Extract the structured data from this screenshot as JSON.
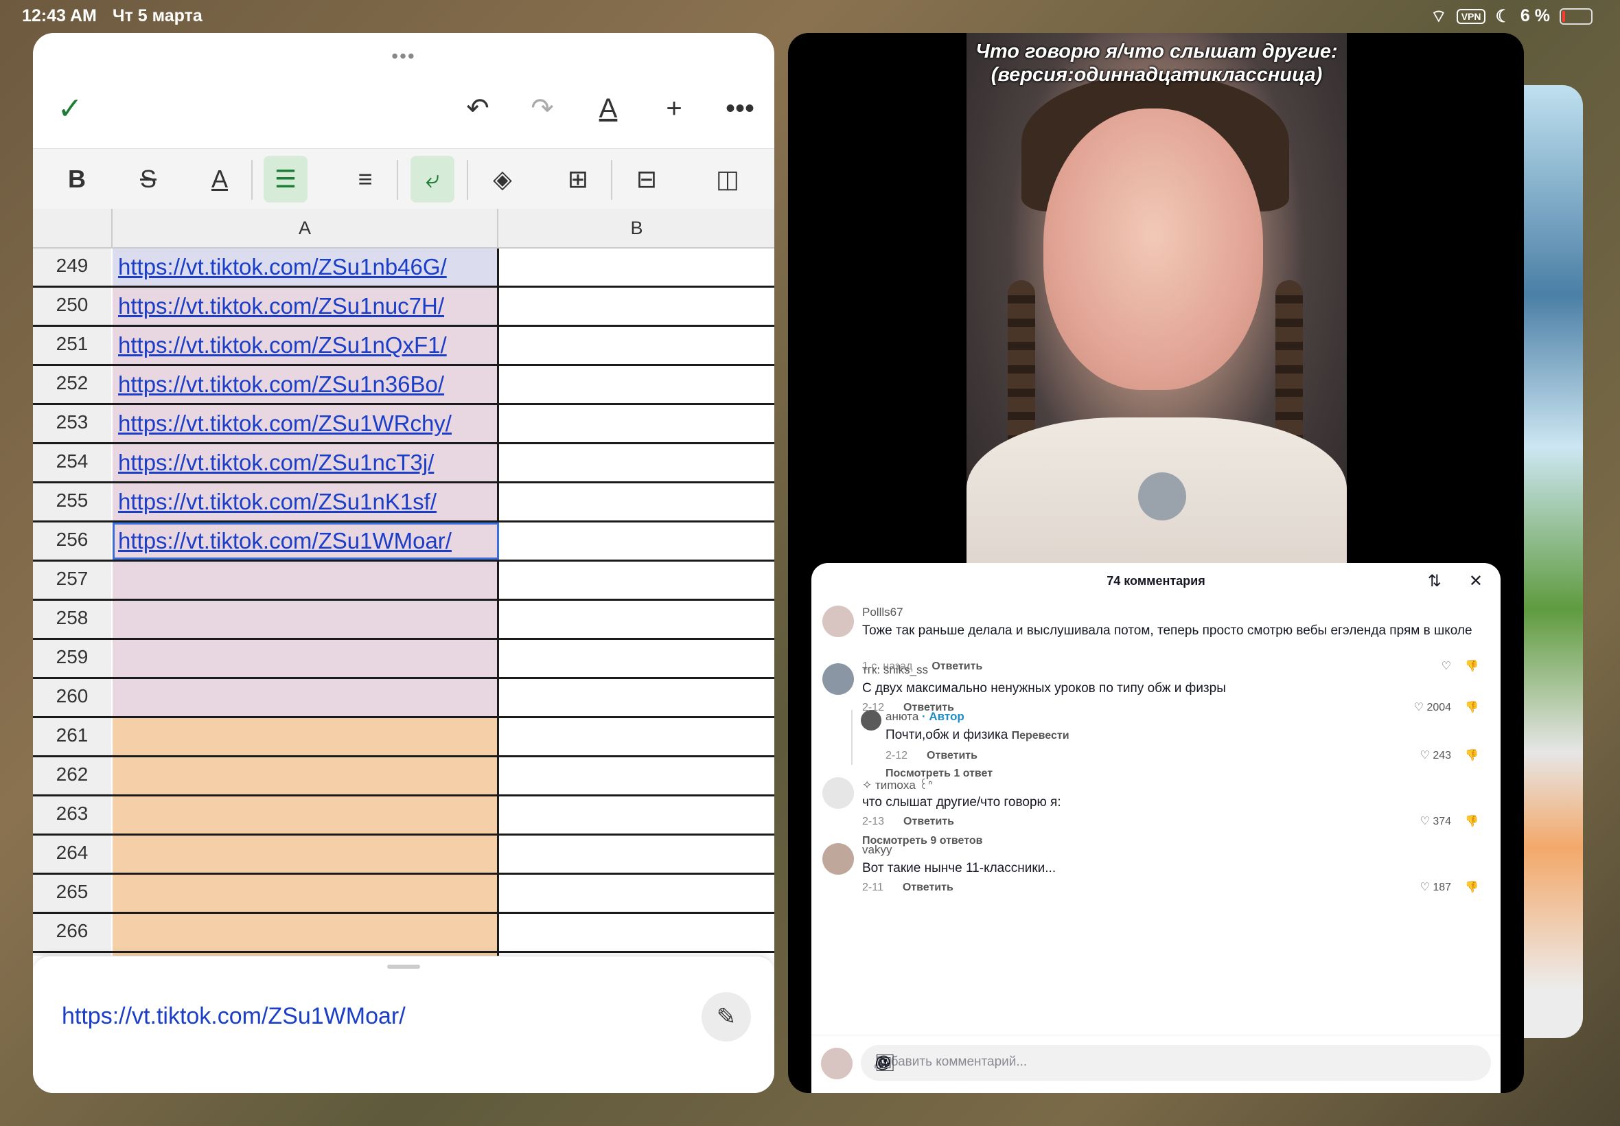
{
  "status": {
    "time": "12:43 AM",
    "date": "Чт 5 марта",
    "vpn": "VPN",
    "battery": "6 %"
  },
  "sheet": {
    "col_a": "A",
    "col_b": "B",
    "rows": [
      {
        "num": "249",
        "link": "https://vt.tiktok.com/ZSu1nb46G/",
        "color": "#dcdcef"
      },
      {
        "num": "250",
        "link": "https://vt.tiktok.com/ZSu1nuc7H/",
        "color": "#e8d6e0"
      },
      {
        "num": "251",
        "link": "https://vt.tiktok.com/ZSu1nQxF1/",
        "color": "#e8d6e0"
      },
      {
        "num": "252",
        "link": "https://vt.tiktok.com/ZSu1n36Bo/",
        "color": "#e8d6e0"
      },
      {
        "num": "253",
        "link": "https://vt.tiktok.com/ZSu1WRchy/",
        "color": "#e8d6e0"
      },
      {
        "num": "254",
        "link": "https://vt.tiktok.com/ZSu1ncT3j/",
        "color": "#e8d6e0"
      },
      {
        "num": "255",
        "link": "https://vt.tiktok.com/ZSu1nK1sf/",
        "color": "#e8d6e0"
      },
      {
        "num": "256",
        "link": "https://vt.tiktok.com/ZSu1WMoar/",
        "color": "#e8d6e0"
      },
      {
        "num": "257",
        "link": "",
        "color": "#e8d6e0"
      },
      {
        "num": "258",
        "link": "",
        "color": "#e8d6e0"
      },
      {
        "num": "259",
        "link": "",
        "color": "#e8d6e0"
      },
      {
        "num": "260",
        "link": "",
        "color": "#e8d6e0"
      },
      {
        "num": "261",
        "link": "",
        "color": "#f4cfa8"
      },
      {
        "num": "262",
        "link": "",
        "color": "#f4cfa8"
      },
      {
        "num": "263",
        "link": "",
        "color": "#f4cfa8"
      },
      {
        "num": "264",
        "link": "",
        "color": "#f4cfa8"
      },
      {
        "num": "265",
        "link": "",
        "color": "#f4cfa8"
      },
      {
        "num": "266",
        "link": "",
        "color": "#f4cfa8"
      },
      {
        "num": "267",
        "link": "",
        "color": "#f4cfa8"
      }
    ],
    "formula_value": "https://vt.tiktok.com/ZSu1WMoar/"
  },
  "video": {
    "title_line1": "Что говорю я/что слышат другие:",
    "title_line2": "(версия:одиннадцатиклассница)"
  },
  "comments": {
    "header": "74 комментария",
    "input_placeholder": "Добавить комментарий...",
    "reply_label": "Ответить",
    "items": [
      {
        "user": "Pollls67",
        "text": "Тоже так раньше делала и выслушивала потом, теперь просто смотрю вебы егэленда прям в школе",
        "time": "1 с. назад",
        "likes": ""
      },
      {
        "user": "тгк: sniks_ss",
        "text": "С двух максимально ненужных уроков по типу обж и физры",
        "time": "2-12",
        "likes": "2004"
      },
      {
        "user": "анюта",
        "author_tag": "· Автор",
        "text": "Почти,обж и физика",
        "translate": "Перевести",
        "time": "2-12",
        "likes": "243",
        "more": "Посмотреть 1 ответ"
      },
      {
        "user": "✧ тиmoxa ꒰ᐢ",
        "text": "что слышат другие/что говорю я:",
        "time": "2-13",
        "likes": "374",
        "more": "Посмотреть 9 ответов"
      },
      {
        "user": "vakyy",
        "text": "Вот такие нынче 11-классники...",
        "time": "2-11",
        "likes": "187"
      }
    ]
  }
}
